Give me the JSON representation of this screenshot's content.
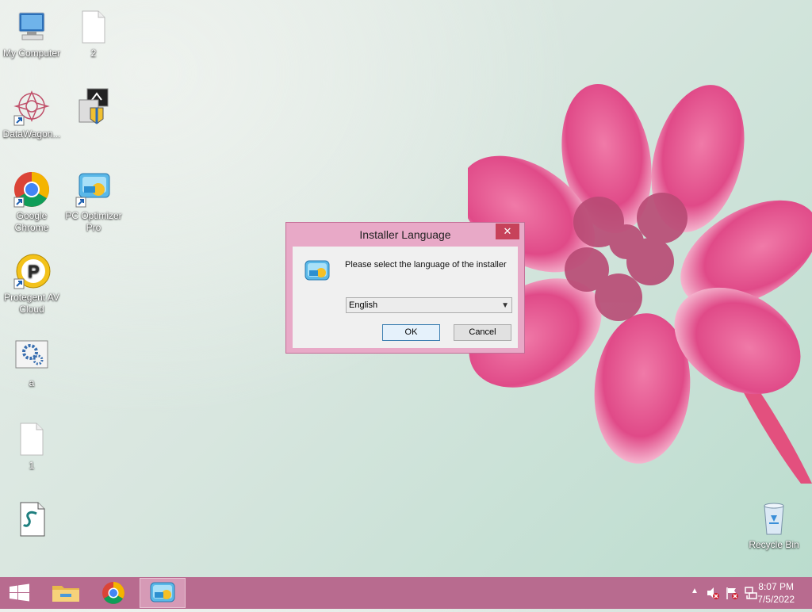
{
  "desktop": {
    "icons": [
      {
        "label": "My Computer"
      },
      {
        "label": "2"
      },
      {
        "label": "DataWagon..."
      },
      {
        "label": ""
      },
      {
        "label": "Google Chrome"
      },
      {
        "label": "PC Optimizer Pro"
      },
      {
        "label": "Protegent AV Cloud"
      },
      {
        "label": "a"
      },
      {
        "label": "1"
      },
      {
        "label": ""
      },
      {
        "label": "Recycle Bin"
      }
    ]
  },
  "dialog": {
    "title": "Installer Language",
    "close_label": "✕",
    "message": "Please select the language of the installer",
    "language_selected": "English",
    "ok_label": "OK",
    "cancel_label": "Cancel"
  },
  "taskbar": {
    "clock_time": "8:07 PM",
    "clock_date": "7/5/2022"
  },
  "colors": {
    "taskbar": "#b86b8f",
    "dialog_frame": "#e8a9c7",
    "close_button": "#c7425a"
  }
}
